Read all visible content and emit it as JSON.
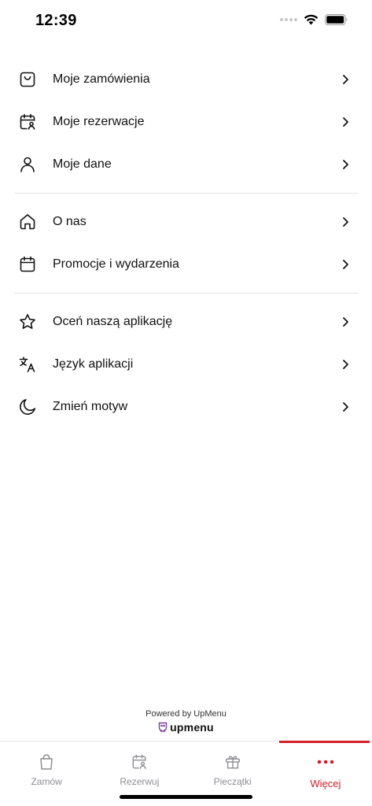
{
  "status": {
    "time": "12:39"
  },
  "colors": {
    "accent": "#d21f2b",
    "text": "#111111",
    "muted": "#8e8e93",
    "divider": "#e4e4e4"
  },
  "menu": {
    "group1": [
      {
        "label": "Moje zamówienia",
        "icon": "shopping-bag-icon"
      },
      {
        "label": "Moje rezerwacje",
        "icon": "calendar-user-icon"
      },
      {
        "label": "Moje dane",
        "icon": "user-icon"
      }
    ],
    "group2": [
      {
        "label": "O nas",
        "icon": "home-icon"
      },
      {
        "label": "Promocje i wydarzenia",
        "icon": "calendar-icon"
      }
    ],
    "group3": [
      {
        "label": "Oceń naszą aplikację",
        "icon": "star-icon"
      },
      {
        "label": "Język aplikacji",
        "icon": "translate-icon"
      },
      {
        "label": "Zmień motyw",
        "icon": "moon-icon"
      }
    ]
  },
  "footer": {
    "powered_by": "Powered by UpMenu",
    "brand": "upmenu"
  },
  "tabs": [
    {
      "label": "Zamów",
      "icon": "shopping-bag-icon"
    },
    {
      "label": "Rezerwuj",
      "icon": "calendar-user-icon"
    },
    {
      "label": "Pieczątki",
      "icon": "gift-icon"
    },
    {
      "label": "Więcej",
      "icon": "more-dots-icon",
      "active": true
    }
  ]
}
